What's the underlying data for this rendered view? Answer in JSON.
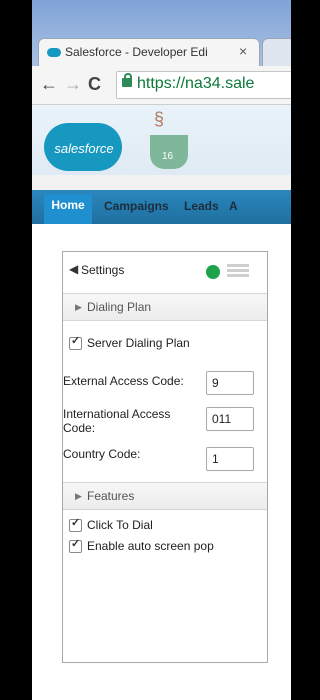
{
  "browser": {
    "tab_title": "Salesforce - Developer Edi",
    "tab_close": "×",
    "url": "https://na34.sale",
    "nav_back": "←",
    "nav_forward": "→",
    "nav_reload": "C"
  },
  "salesforce": {
    "logo_text": "salesforce",
    "mascot_number": "16",
    "tabs": [
      "Home",
      "Campaigns",
      "Leads",
      "A"
    ]
  },
  "settings_panel": {
    "back_arrow": "◀",
    "title": "Settings",
    "status_color": "#1fa34a",
    "dialing_plan": {
      "caret": "▶",
      "label": "Dialing Plan",
      "server_dialing_plan": {
        "label": "Server Dialing Plan",
        "checked": true
      },
      "external_access_code": {
        "label": "External Access Code:",
        "value": "9"
      },
      "international_access_code": {
        "label_line1": "International Access",
        "label_line2": "Code:",
        "value": "011"
      },
      "country_code": {
        "label": "Country Code:",
        "value": "1"
      }
    },
    "features": {
      "caret": "▶",
      "label": "Features",
      "click_to_dial": {
        "label": "Click To Dial",
        "checked": true
      },
      "auto_screen_pop": {
        "label": "Enable auto screen pop",
        "checked": true
      }
    }
  }
}
